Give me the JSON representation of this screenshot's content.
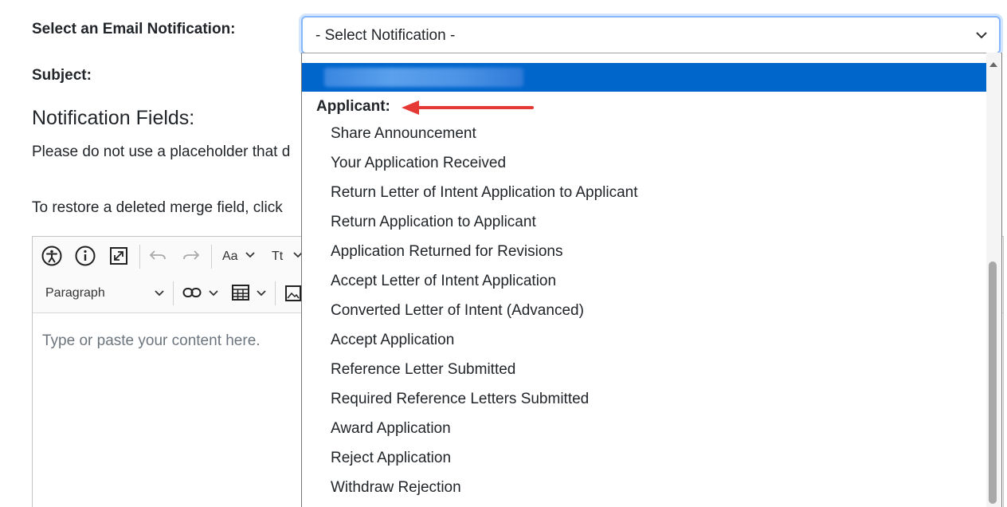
{
  "form": {
    "email_notification_label": "Select an Email Notification:",
    "subject_label": "Subject:",
    "notification_fields_heading": "Notification Fields:",
    "placeholder_note": "Please do not use a placeholder that d",
    "restore_note": "To restore a deleted merge field, click"
  },
  "select": {
    "value": "- Select Notification -"
  },
  "editor": {
    "font_size_label": "Aa",
    "text_style_label": "Tt",
    "paragraph_label": "Paragraph",
    "placeholder": "Type or paste your content here."
  },
  "dropdown": {
    "group_label": "Applicant:",
    "options": [
      "Share Announcement",
      "Your Application Received",
      "Return Letter of Intent Application to Applicant",
      "Return Application to Applicant",
      "Application Returned for Revisions",
      "Accept Letter of Intent Application",
      "Converted Letter of Intent (Advanced)",
      "Accept Application",
      "Reference Letter Submitted",
      "Required Reference Letters Submitted",
      "Award Application",
      "Reject Application",
      "Withdraw Rejection"
    ]
  },
  "colors": {
    "selected_row": "#0066cc",
    "focus_border": "#86b7fe",
    "annotation_arrow": "#e53935"
  },
  "icons": {
    "accessibility": "accessibility-icon",
    "info": "info-icon",
    "fullscreen": "fullscreen-icon",
    "undo": "undo-icon",
    "redo": "redo-icon",
    "link": "link-icon",
    "table": "table-icon",
    "image": "image-icon",
    "chevron": "chevron-down-icon"
  }
}
